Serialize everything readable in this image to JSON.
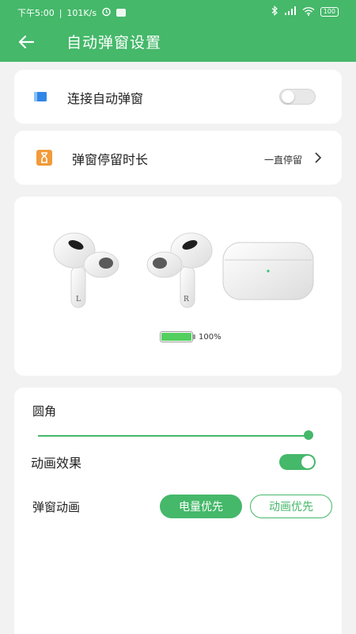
{
  "status_bar": {
    "time": "下午5:00",
    "speed": "101K/s",
    "battery": "100"
  },
  "header": {
    "title": "自动弹窗设置"
  },
  "auto_popup": {
    "label": "连接自动弹窗",
    "enabled": false
  },
  "popup_duration": {
    "label": "弹窗停留时长",
    "value": "一直停留"
  },
  "preview": {
    "left_mark": "L",
    "right_mark": "R",
    "battery_percent_text": "100%",
    "battery_level": 1.0
  },
  "settings": {
    "corner_label": "圆角",
    "corner_value": 1.0,
    "animation_label": "动画效果",
    "animation_enabled": true,
    "popup_animation_label": "弹窗动画",
    "options": [
      "电量优先",
      "动画优先"
    ],
    "selected_option": "电量优先"
  },
  "colors": {
    "accent": "#45b86a",
    "battery_fill": "#52cf5e"
  }
}
